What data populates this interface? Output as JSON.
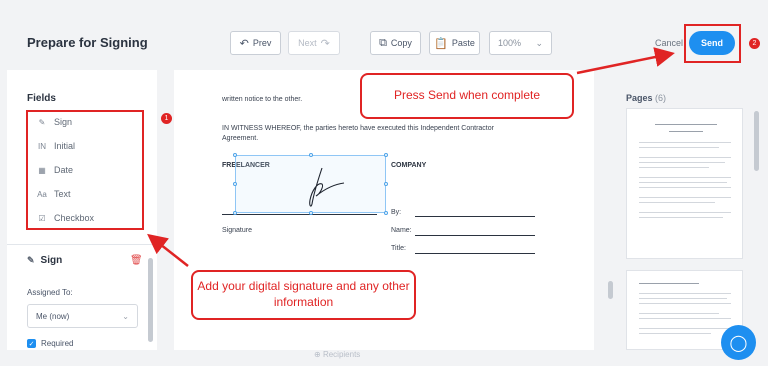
{
  "header": {
    "title": "Prepare for Signing",
    "prev_label": "Prev",
    "next_label": "Next",
    "copy_label": "Copy",
    "paste_label": "Paste",
    "zoom_value": "100%",
    "cancel_label": "Cancel",
    "send_label": "Send",
    "send_badge": "2"
  },
  "fields_panel": {
    "title": "Fields",
    "badge": "1",
    "items": [
      {
        "icon": "signature-icon",
        "glyph": "✎",
        "label": "Sign"
      },
      {
        "icon": "initial-icon",
        "glyph": "IN",
        "label": "Initial"
      },
      {
        "icon": "calendar-icon",
        "glyph": "▦",
        "label": "Date"
      },
      {
        "icon": "text-icon",
        "glyph": "Aa",
        "label": "Text"
      },
      {
        "icon": "checkbox-icon",
        "glyph": "☑",
        "label": "Checkbox"
      }
    ]
  },
  "sign_settings": {
    "title": "Sign",
    "assigned_label": "Assigned To:",
    "assigned_value": "Me (now)",
    "required_label": "Required"
  },
  "document": {
    "line1": "written notice to the other.",
    "line2": "IN WITNESS WHEREOF, the parties hereto have executed this Independent Contractor",
    "line3": "Agreement.",
    "freelancer": "FREELANCER",
    "company": "COMPANY",
    "by_label": "By:",
    "signature_label": "Signature",
    "name_label": "Name:",
    "title_label": "Title:"
  },
  "pages_panel": {
    "title": "Pages",
    "count": "(6)"
  },
  "callouts": {
    "send": "Press Send when complete",
    "fields": "Add your digital signature and any other information"
  },
  "footer": {
    "recipients": "Recipients"
  },
  "colors": {
    "accent": "#1e8ff0",
    "annotation": "#e02424"
  }
}
